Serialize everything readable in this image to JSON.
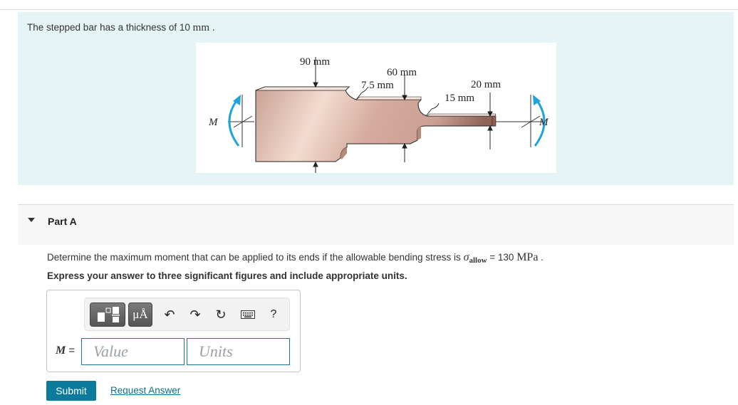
{
  "intro": {
    "text_prefix": "The stepped bar has a thickness of 10 ",
    "unit": "mm",
    "text_suffix": " ."
  },
  "figure": {
    "labels": {
      "dim_90": "90 mm",
      "dim_60": "60 mm",
      "dim_7_5": "7.5 mm",
      "dim_20": "20 mm",
      "dim_15": "15 mm",
      "moment_left": "M",
      "moment_right": "M"
    },
    "colors": {
      "bar": "#d9b3a6",
      "bar_light": "#f0d8ce",
      "bar_dark": "#9e7063",
      "arrow": "#1ea3dc"
    }
  },
  "part": {
    "label": "Part A",
    "expanded": true
  },
  "question": {
    "text": "Determine the maximum moment that can be applied to its ends if the allowable bending stress is ",
    "sigma": "σ",
    "subscript": "allow",
    "equals": " = 130 ",
    "unit": "MPa",
    "end": " .",
    "instruction": "Express your answer to three significant figures and include appropriate units."
  },
  "toolbar": {
    "templates_icon": "templates-icon",
    "units_label": "μÅ",
    "undo": "↶",
    "redo": "↷",
    "reset": "↻",
    "keyboard_icon": "keyboard-icon",
    "help": "?"
  },
  "answer": {
    "variable": "M",
    "equals": " =",
    "value_placeholder": "Value",
    "units_placeholder": "Units"
  },
  "actions": {
    "submit": "Submit",
    "request_answer": "Request Answer"
  }
}
